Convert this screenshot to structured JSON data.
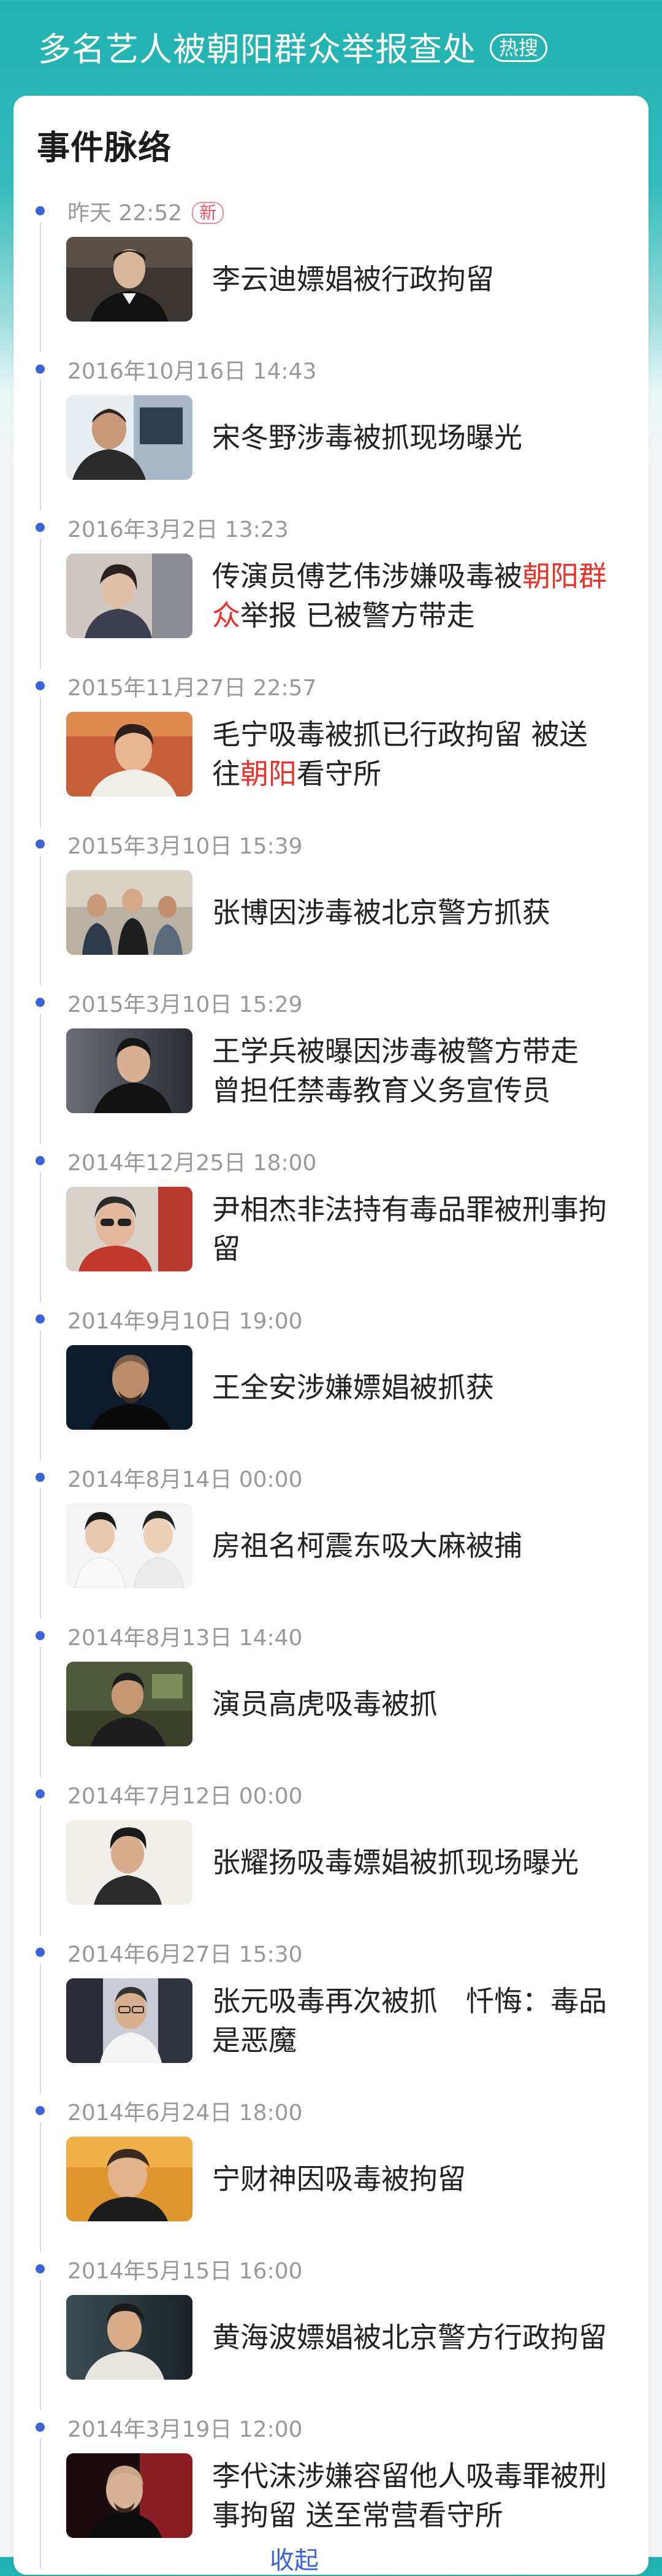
{
  "header": {
    "title": "多名艺人被朝阳群众举报查处",
    "badge": "热搜"
  },
  "card": {
    "title": "事件脉络"
  },
  "events": [
    {
      "time": "昨天 22:52",
      "badge": "新",
      "headline": "李云迪嫖娼被行政拘留"
    },
    {
      "time": "2016年10月16日 14:43",
      "headline": "宋冬野涉毒被抓现场曝光"
    },
    {
      "time": "2016年3月2日 13:23",
      "headline_parts": [
        "传演员傅艺伟涉嫌吸毒被",
        "朝阳群",
        "众",
        "举报 已被警方带走"
      ]
    },
    {
      "time": "2015年11月27日 22:57",
      "headline_parts": [
        "毛宁吸毒被抓已行政拘留 被送",
        "往",
        "朝阳",
        "看守所"
      ]
    },
    {
      "time": "2015年3月10日 15:39",
      "headline": "张博因涉毒被北京警方抓获"
    },
    {
      "time": "2015年3月10日 15:29",
      "headline_lines": [
        "王学兵被曝因涉毒被警方带走",
        "曾担任禁毒教育义务宣传员"
      ]
    },
    {
      "time": "2014年12月25日 18:00",
      "headline_lines": [
        "尹相杰非法持有毒品罪被刑事拘",
        "留"
      ]
    },
    {
      "time": "2014年9月10日 19:00",
      "headline": "王全安涉嫌嫖娼被抓获"
    },
    {
      "time": "2014年8月14日 00:00",
      "headline": "房祖名柯震东吸大麻被捕"
    },
    {
      "time": "2014年8月13日 14:40",
      "headline": "演员高虎吸毒被抓"
    },
    {
      "time": "2014年7月12日 00:00",
      "headline": "张耀扬吸毒嫖娼被抓现场曝光"
    },
    {
      "time": "2014年6月27日 15:30",
      "headline_lines": [
        "张元吸毒再次被抓　忏悔：毒品",
        "是恶魔"
      ]
    },
    {
      "time": "2014年6月24日 18:00",
      "headline": "宁财神因吸毒被拘留"
    },
    {
      "time": "2014年5月15日 16:00",
      "headline": "黄海波嫖娼被北京警方行政拘留"
    },
    {
      "time": "2014年3月19日 12:00",
      "headline_lines": [
        "李代沫涉嫌容留他人吸毒罪被刑",
        "事拘留 送至常营看守所"
      ]
    }
  ],
  "footer": {
    "more_label": "收起"
  },
  "colors": {
    "accent_teal": "#20b1b0",
    "timeline_dot": "#3b64d9",
    "highlight_red": "#e8322a",
    "new_badge": "#e8556a"
  }
}
